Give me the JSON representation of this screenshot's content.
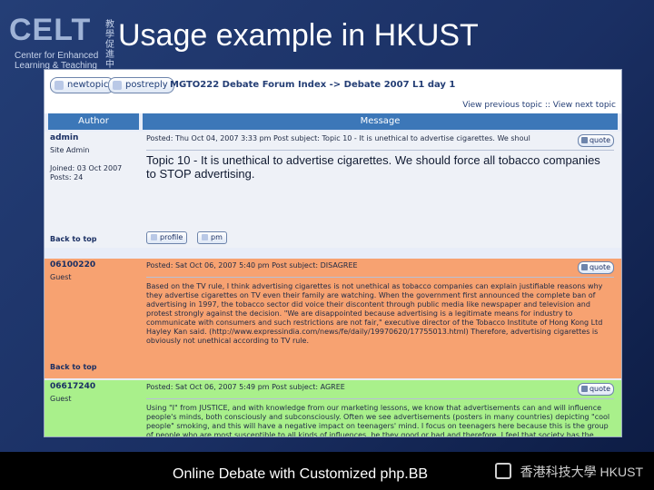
{
  "slide": {
    "logo_main": "CELT",
    "logo_cjk": "教學促進中心",
    "logo_sub_line1": "Center for Enhanced",
    "logo_sub_line2": "Learning & Teaching",
    "title": "Usage example in HKUST",
    "footer_left": "Online Debate with Customized php.BB",
    "footer_right_cjk": "香港科技大學",
    "footer_right_en": "HKUST"
  },
  "forum": {
    "buttons": {
      "new_topic": "newtopic",
      "post_reply": "postreply"
    },
    "breadcrumb": "MGTO222 Debate Forum Index -> Debate 2007 L1 day 1",
    "pager": {
      "prev": "View previous topic",
      "sep": "::",
      "next": "View next topic"
    },
    "table_headers": {
      "author": "Author",
      "message": "Message"
    },
    "posts": [
      {
        "author_name": "admin",
        "author_meta": "Site Admin\n\nJoined: 03 Oct 2007\nPosts: 24",
        "back_to_top": "Back to top",
        "posted_line": "Posted: Thu Oct 04, 2007 3:33 pm    Post subject: Topic 10 - It is unethical to advertise cigarettes. We shoul",
        "quote_label": "quote",
        "headline": "Topic 10 - It is unethical to advertise cigarettes. We should force all tobacco companies to STOP advertising.",
        "profile_label": "profile",
        "pm_label": "pm"
      },
      {
        "author_name": "06100220",
        "author_meta": "Guest",
        "back_to_top": "Back to top",
        "posted_line": "Posted: Sat Oct 06, 2007 5:40 pm    Post subject: DISAGREE",
        "quote_label": "quote",
        "body": "Based on the TV rule, I think advertising cigarettes is not unethical as tobacco companies can explain justifiable reasons why they advertise cigarettes on TV even their family are watching. When the government first announced the complete ban of advertising in 1997, the tobacco sector did voice their discontent through public media like newspaper and television and protest strongly against the decision. \"We are disappointed because advertising is a legitimate means for industry to communicate with consumers and such restrictions are not fair,\" executive director of the Tobacco Institute of Hong Kong Ltd Hayley Kan said. (http://www.expressindia.com/news/fe/daily/19970620/17755013.html) Therefore, advertising cigarettes is obviously not unethical according to TV rule."
      },
      {
        "author_name": "06617240",
        "author_meta": "Guest",
        "posted_line": "Posted: Sat Oct 06, 2007 5:49 pm    Post subject: AGREE",
        "quote_label": "quote",
        "body": "Using \"I\" from JUSTICE, and with knowledge from our marketing lessons, we know that advertisements can and will influence people's minds, both consciously and subconsciously. Often we see advertisements (posters in many countries) depicting \"cool people\" smoking, and this will have a negative impact on teenagers' mind. I focus on teenagers here because this is the group of people who are most susceptible to all kinds of influences, be they good or bad and therefore, I feel that society has the responsibility and obligation to prevent people, especially youngsters, from being exposed to advertisements which have high potentials to induce people to take up smoking which is harmful and both to the individual and the society as a whole. So it is unethical to advertise cigarettes and we should force all tobacco companies to stop advertising."
      }
    ]
  }
}
